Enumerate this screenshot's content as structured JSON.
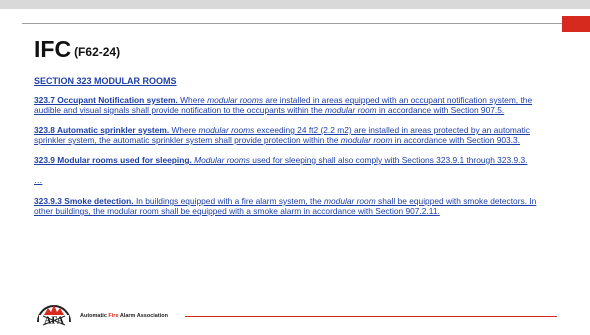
{
  "slide": {
    "title": "IFC",
    "code": "(F62-24)",
    "section_heading": "SECTION 323 MODULAR ROOMS",
    "paragraphs": [
      {
        "num": "323.7 Occupant Notification system.",
        "t1": " Where ",
        "i1": "modular rooms",
        "t2": " are installed in areas equipped with an occupant notification system, the audible and visual signals shall provide notification to the occupants within the ",
        "i2": "modular room",
        "t3": " in accordance with Section 907.5."
      },
      {
        "num": "323.8 Automatic sprinkler system.",
        "t1": " Where ",
        "i1": "modular rooms",
        "t2": " exceeding 24 ft2 (2.2 m2) are installed in areas protected by an automatic sprinkler system, the automatic sprinkler system shall provide protection within the ",
        "i2": "modular room",
        "t3": " in accordance with Section 903.3."
      },
      {
        "num": "323.9 Modular rooms used for sleeping.",
        "t1": " ",
        "i1": "Modular rooms",
        "t2": " used for sleeping shall also comply with Sections 323.9.1 through 323.9.3.",
        "i2": "",
        "t3": ""
      },
      {
        "num": "323.9.3 Smoke detection.",
        "t1": " In buildings equipped with a fire alarm system, the ",
        "i1": "modular room",
        "t2": " shall be equipped with smoke detectors. In other buildings, the modular room shall be equipped with a smoke alarm in accordance with Section 907.2.11.",
        "i2": "",
        "t3": ""
      }
    ],
    "ellipsis": "…"
  },
  "footer": {
    "org_prefix": "Automatic ",
    "org_fire": "Fire",
    "org_suffix": " Alarm Association",
    "logo_letters": "AFA"
  },
  "colors": {
    "accent_red": "#d72a1e",
    "link_blue": "#1f3fa8"
  }
}
